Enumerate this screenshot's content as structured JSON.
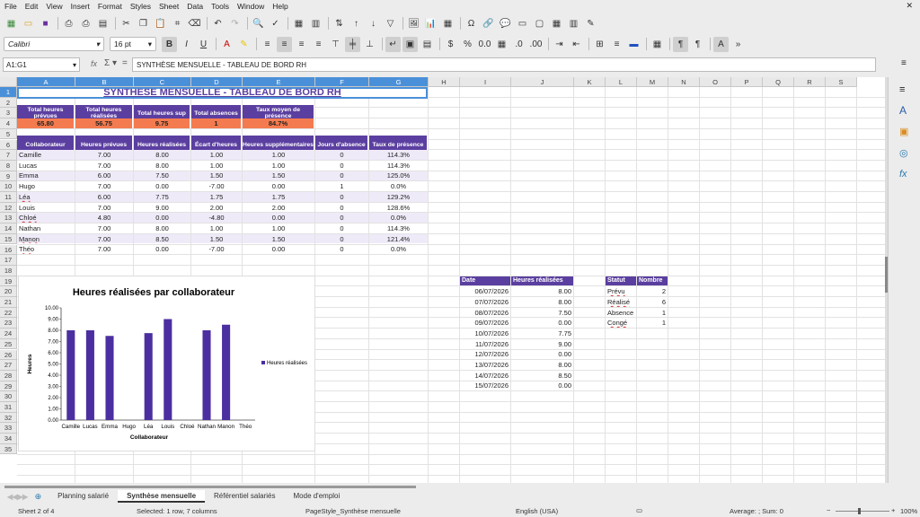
{
  "menu": [
    "File",
    "Edit",
    "View",
    "Insert",
    "Format",
    "Styles",
    "Sheet",
    "Data",
    "Tools",
    "Window",
    "Help"
  ],
  "font": {
    "name": "Calibri",
    "size": "16 pt"
  },
  "namebox": "A1:G1",
  "formula": "SYNTHÈSE MENSUELLE - TABLEAU DE BORD RH",
  "columns": [
    "A",
    "B",
    "C",
    "D",
    "E",
    "F",
    "G",
    "H",
    "I",
    "J",
    "K",
    "L",
    "M",
    "N",
    "O",
    "P",
    "Q",
    "R",
    "S"
  ],
  "rows": [
    "1",
    "2",
    "3",
    "4",
    "5",
    "6",
    "7",
    "8",
    "9",
    "10",
    "11",
    "12",
    "13",
    "14",
    "15",
    "16",
    "17",
    "18",
    "19",
    "20",
    "21",
    "22",
    "23",
    "24",
    "25",
    "26",
    "27",
    "28",
    "29",
    "30",
    "31",
    "32",
    "33",
    "34",
    "35"
  ],
  "title": "SYNTHÈSE MENSUELLE - TABLEAU DE BORD RH",
  "kpi_headers": [
    "Total heures prévues",
    "Total heures réalisées",
    "Total heures sup",
    "Total absences",
    "Taux moyen de présence"
  ],
  "kpi_values": [
    "65.80",
    "56.75",
    "9.75",
    "1",
    "84.7%"
  ],
  "table_headers": [
    "Collaborateur",
    "Heures prévues",
    "Heures réalisées",
    "Écart d'heures",
    "Heures supplémentaires",
    "Jours d'absence",
    "Taux de présence"
  ],
  "table_rows": [
    [
      "Camille",
      "7.00",
      "8.00",
      "1.00",
      "1.00",
      "0",
      "114.3%"
    ],
    [
      "Lucas",
      "7.00",
      "8.00",
      "1.00",
      "1.00",
      "0",
      "114.3%"
    ],
    [
      "Emma",
      "6.00",
      "7.50",
      "1.50",
      "1.50",
      "0",
      "125.0%"
    ],
    [
      "Hugo",
      "7.00",
      "0.00",
      "-7.00",
      "0.00",
      "1",
      "0.0%"
    ],
    [
      "Léa",
      "6.00",
      "7.75",
      "1.75",
      "1.75",
      "0",
      "129.2%"
    ],
    [
      "Louis",
      "7.00",
      "9.00",
      "2.00",
      "2.00",
      "0",
      "128.6%"
    ],
    [
      "Chloé",
      "4.80",
      "0.00",
      "-4.80",
      "0.00",
      "0",
      "0.0%"
    ],
    [
      "Nathan",
      "7.00",
      "8.00",
      "1.00",
      "1.00",
      "0",
      "114.3%"
    ],
    [
      "Manon",
      "7.00",
      "8.50",
      "1.50",
      "1.50",
      "0",
      "121.4%"
    ],
    [
      "Théo",
      "7.00",
      "0.00",
      "-7.00",
      "0.00",
      "0",
      "0.0%"
    ]
  ],
  "date_table": {
    "headers": [
      "Date",
      "Heures réalisées"
    ],
    "rows": [
      [
        "06/07/2026",
        "8.00"
      ],
      [
        "07/07/2026",
        "8.00"
      ],
      [
        "08/07/2026",
        "7.50"
      ],
      [
        "09/07/2026",
        "0.00"
      ],
      [
        "10/07/2026",
        "7.75"
      ],
      [
        "11/07/2026",
        "9.00"
      ],
      [
        "12/07/2026",
        "0.00"
      ],
      [
        "13/07/2026",
        "8.00"
      ],
      [
        "14/07/2026",
        "8.50"
      ],
      [
        "15/07/2026",
        "0.00"
      ]
    ]
  },
  "status_table": {
    "headers": [
      "Statut",
      "Nombre"
    ],
    "rows": [
      [
        "Prévu",
        "2"
      ],
      [
        "Réalisé",
        "6"
      ],
      [
        "Absence",
        "1"
      ],
      [
        "Congé",
        "1"
      ]
    ]
  },
  "chart_data": {
    "type": "bar",
    "title": "Heures réalisées par collaborateur",
    "xlabel": "Collaborateur",
    "ylabel": "Heures",
    "categories": [
      "Camille",
      "Lucas",
      "Emma",
      "Hugo",
      "Léa",
      "Louis",
      "Chloé",
      "Nathan",
      "Manon",
      "Théo"
    ],
    "series": [
      {
        "name": "Heures réalisées",
        "values": [
          8.0,
          8.0,
          7.5,
          0.0,
          7.75,
          9.0,
          0.0,
          8.0,
          8.5,
          0.0
        ]
      }
    ],
    "ylim": [
      0,
      10
    ],
    "yticks": [
      "0.00",
      "1.00",
      "2.00",
      "3.00",
      "4.00",
      "5.00",
      "6.00",
      "7.00",
      "8.00",
      "9.00",
      "10.00"
    ],
    "legend": "right",
    "color": "#4b2fa0"
  },
  "sheet_tabs": [
    "Planning salarié",
    "Synthèse mensuelle",
    "Référentiel salariés",
    "Mode d'emploi"
  ],
  "status": {
    "sheet": "Sheet 2 of 4",
    "selection": "Selected: 1 row, 7 columns",
    "style": "PageStyle_Synthèse mensuelle",
    "lang": "English (USA)",
    "sum": "Average: ; Sum: 0",
    "zoom": "100%"
  }
}
